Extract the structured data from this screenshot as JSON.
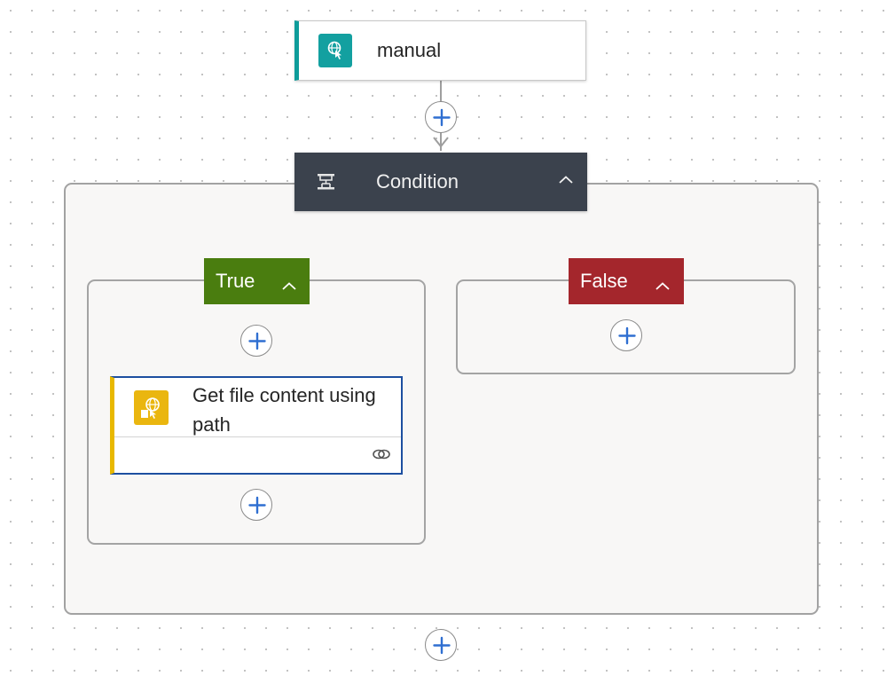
{
  "trigger": {
    "label": "manual",
    "icon": "trigger-globe-icon",
    "accent_color": "#0e9c9a"
  },
  "condition": {
    "label": "Condition",
    "icon": "condition-icon",
    "collapse_icon": "chevron-up-icon",
    "header_color": "#3b424d"
  },
  "branches": {
    "true": {
      "label": "True",
      "color": "#4a7d0f",
      "collapse_icon": "chevron-up-icon",
      "actions": [
        {
          "label": "Get file content using path",
          "icon": "file-globe-icon",
          "accent_color": "#e8b800",
          "footer_icon": "link-icon"
        }
      ]
    },
    "false": {
      "label": "False",
      "color": "#a4262c",
      "collapse_icon": "chevron-up-icon",
      "actions": []
    }
  },
  "add_step_icon": "plus-icon"
}
